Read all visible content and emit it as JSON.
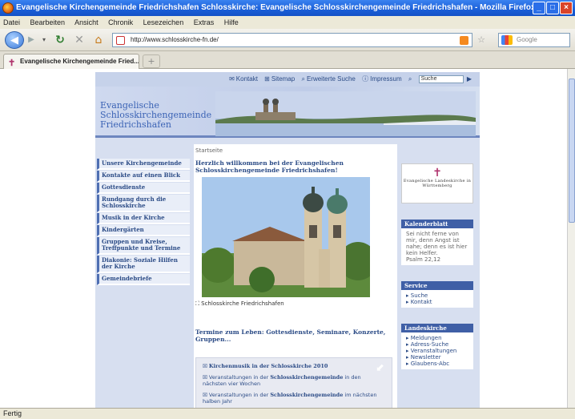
{
  "window": {
    "title": "Evangelische Kirchengemeinde Friedrichshafen Schlosskirche: Evangelische Schlosskirchengemeinde Friedrichshafen - Mozilla Firefox"
  },
  "menubar": [
    "Datei",
    "Bearbeiten",
    "Ansicht",
    "Chronik",
    "Lesezeichen",
    "Extras",
    "Hilfe"
  ],
  "navbar": {
    "url": "http://www.schlosskirche-fn.de/",
    "search_placeholder": "Google"
  },
  "tabs": [
    {
      "label": "Evangelische Kirchengemeinde Fried..."
    }
  ],
  "status": "Fertig",
  "site": {
    "toplinks": {
      "kontakt": "Kontakt",
      "sitemap": "Sitemap",
      "suche": "Erweiterte Suche",
      "impressum": "Impressum",
      "search_value": "Suche"
    },
    "brand": "Evangelische Schlosskirchengemeinde Friedrichshafen",
    "nav": [
      "Unsere Kirchengemeinde",
      "Kontakte auf einen Blick",
      "Gottesdienste",
      "Rundgang durch die Schlosskirche",
      "Musik in der Kirche",
      "Kindergärten",
      "Gruppen und Kreise, Treffpunkte und Termine",
      "Diakonie: Soziale Hilfen der Kirche",
      "Gemeindebriefe"
    ],
    "breadcrumb": "Startseite",
    "welcome": "Herzlich willkommen bei der Evangelischen Schlosskirchengemeinde Friedrichshafen!",
    "caption": "Schlosskirche Friedrichshafen",
    "termine": "Termine zum Leben: Gottesdienste, Seminare, Konzerte, Gruppen...",
    "news": [
      {
        "bold": "Kirchenmusik in der Schlosskirche 2010",
        "text": ""
      },
      {
        "pre": "Veranstaltungen in der ",
        "bold": "Schlosskirchengemeinde",
        "text": " in den nächsten vier Wochen"
      },
      {
        "pre": "Veranstaltungen in der ",
        "bold": "Schlosskirchengemeinde",
        "text": " im nächsten halben Jahr"
      }
    ],
    "landeskirche_logo": "Evangelische Landeskirche in Württemberg",
    "kalenderblatt": {
      "title": "Kalenderblatt",
      "text": "Sei nicht ferne von mir, denn Angst ist nahe; denn es ist hier kein Helfer.",
      "ref": "Psalm 22,12"
    },
    "service": {
      "title": "Service",
      "items": [
        "Suche",
        "Kontakt"
      ]
    },
    "landeskirche": {
      "title": "Landeskirche",
      "items": [
        "Meldungen",
        "Adress-Suche",
        "Veranstaltungen",
        "Newsletter",
        "Glaubens-Abc"
      ]
    }
  }
}
